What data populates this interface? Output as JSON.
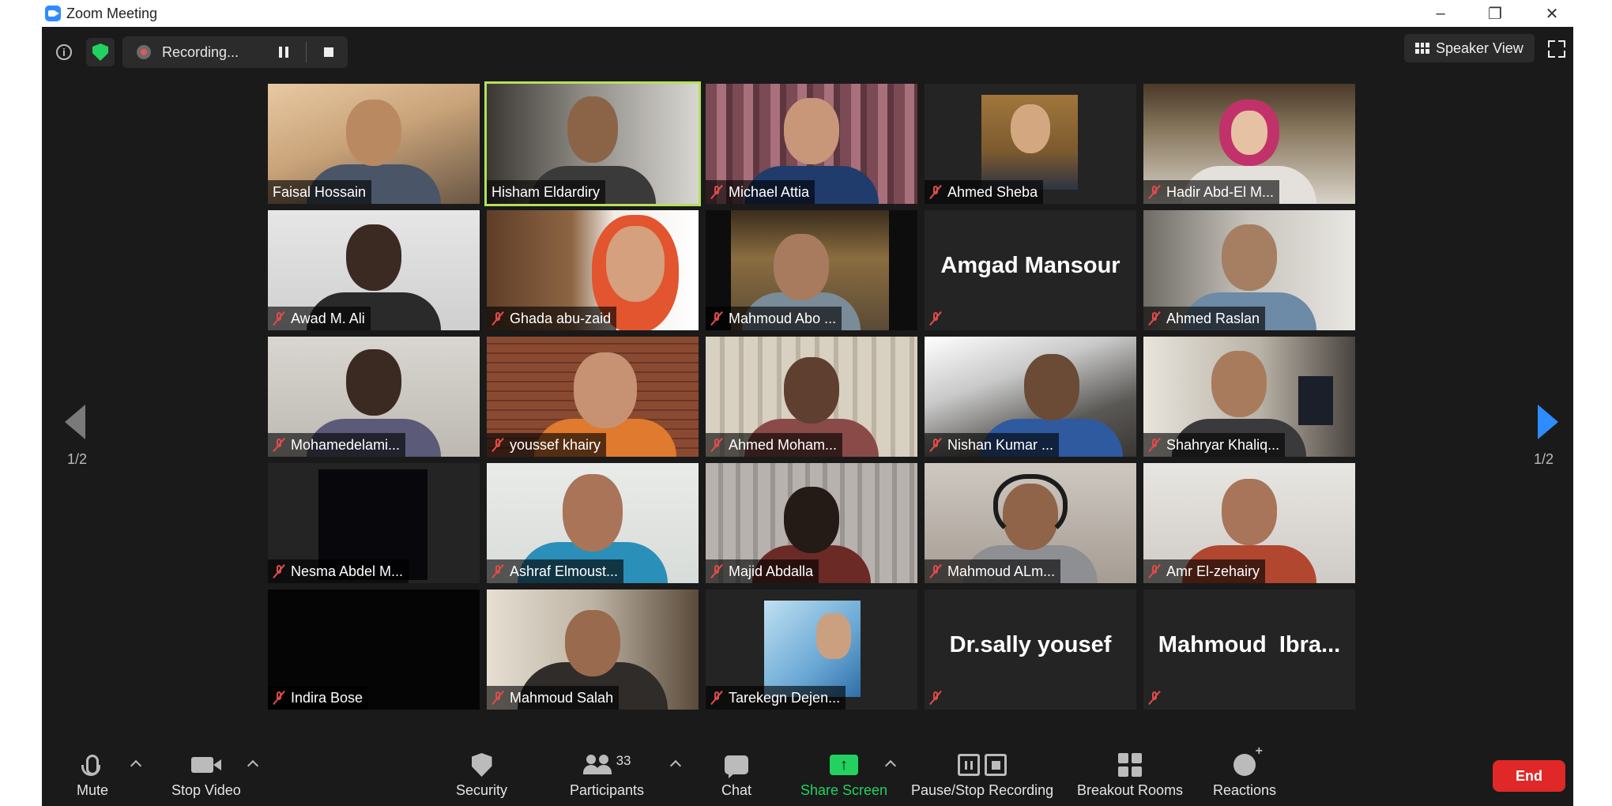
{
  "window": {
    "title": "Zoom Meeting",
    "controls": [
      "minimize-icon",
      "restore-icon",
      "close-icon"
    ]
  },
  "top_bar": {
    "recording_label": "Recording...",
    "speaker_view_label": "Speaker View"
  },
  "pagination": {
    "prev_page": "1/2",
    "next_page": "1/2"
  },
  "participants": [
    {
      "name": "Faisal Hossain",
      "muted": false,
      "video": true
    },
    {
      "name": "Hisham Eldardiry",
      "muted": false,
      "video": true,
      "active_speaker": true
    },
    {
      "name": "Michael Attia",
      "muted": true,
      "video": true
    },
    {
      "name": "Ahmed Sheba",
      "muted": true,
      "video": true
    },
    {
      "name": "Hadir Abd-El M...",
      "muted": true,
      "video": true
    },
    {
      "name": "Awad M. Ali",
      "muted": true,
      "video": true
    },
    {
      "name": "Ghada abu-zaid",
      "muted": true,
      "video": true
    },
    {
      "name": "Mahmoud Abo ...",
      "muted": true,
      "video": true
    },
    {
      "name": "",
      "display_name": "Amgad Mansour",
      "muted": true,
      "video": false
    },
    {
      "name": "Ahmed Raslan",
      "muted": true,
      "video": true
    },
    {
      "name": "Mohamedelami...",
      "muted": true,
      "video": true
    },
    {
      "name": "youssef khairy",
      "muted": true,
      "video": true
    },
    {
      "name": "Ahmed Moham...",
      "muted": true,
      "video": true
    },
    {
      "name": "Nishan Kumar ...",
      "muted": true,
      "video": true
    },
    {
      "name": "Shahryar Khaliq...",
      "muted": true,
      "video": true
    },
    {
      "name": "Nesma Abdel M...",
      "muted": true,
      "video": true
    },
    {
      "name": "Ashraf Elmoust...",
      "muted": true,
      "video": true
    },
    {
      "name": "Majid Abdalla",
      "muted": true,
      "video": true
    },
    {
      "name": "Mahmoud ALm...",
      "muted": true,
      "video": true
    },
    {
      "name": "Amr El-zehairy",
      "muted": true,
      "video": true
    },
    {
      "name": "Indira Bose",
      "muted": true,
      "video": true
    },
    {
      "name": "Mahmoud Salah",
      "muted": true,
      "video": true
    },
    {
      "name": "Tarekegn Dejen...",
      "muted": true,
      "video": true
    },
    {
      "name": "",
      "display_name": "Dr.sally yousef",
      "muted": true,
      "video": false
    },
    {
      "name": "",
      "display_name": "Mahmoud  Ibra...",
      "muted": true,
      "video": false
    }
  ],
  "toolbar": {
    "mute_label": "Mute",
    "stop_video_label": "Stop Video",
    "security_label": "Security",
    "participants_label": "Participants",
    "participants_count": "33",
    "chat_label": "Chat",
    "share_screen_label": "Share Screen",
    "pause_stop_recording_label": "Pause/Stop Recording",
    "breakout_rooms_label": "Breakout Rooms",
    "reactions_label": "Reactions",
    "end_label": "End"
  },
  "colors": {
    "accent": "#2D8CFF",
    "share_green": "#23d160",
    "end_red": "#e02828",
    "active_speaker_border": "#b6e05a",
    "muted_red": "#e04b4b"
  }
}
